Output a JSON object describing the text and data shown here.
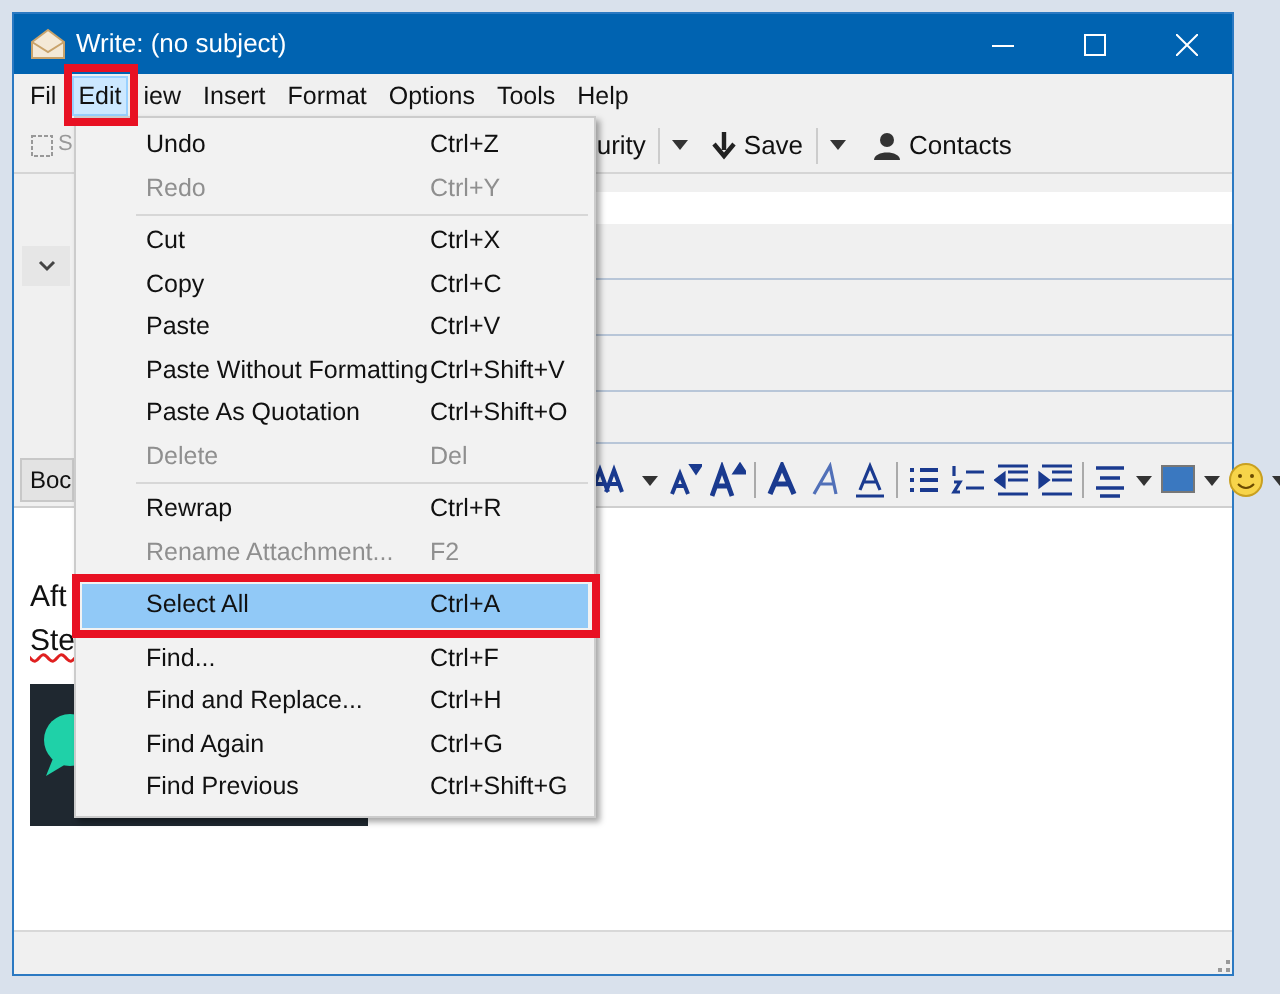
{
  "window": {
    "title": "Write: (no subject)"
  },
  "menubar": [
    {
      "label": "Fil",
      "selected": false
    },
    {
      "label": "Edit",
      "selected": true
    },
    {
      "label": "iew",
      "selected": false
    },
    {
      "label": "Insert",
      "selected": false
    },
    {
      "label": "Format",
      "selected": false
    },
    {
      "label": "Options",
      "selected": false
    },
    {
      "label": "Tools",
      "selected": false
    },
    {
      "label": "Help",
      "selected": false
    }
  ],
  "toolbar": {
    "left_label": "S",
    "security_label": "urity",
    "save_label": "Save",
    "contacts_label": "Contacts"
  },
  "format_toolbar": {
    "paragraph_label": "Boc"
  },
  "body": {
    "lines": [
      "Aft",
      "Ste"
    ]
  },
  "edit_menu": [
    {
      "kind": "item",
      "label": "Undo",
      "shortcut": "Ctrl+Z",
      "disabled": false,
      "selected": false
    },
    {
      "kind": "item",
      "label": "Redo",
      "shortcut": "Ctrl+Y",
      "disabled": true,
      "selected": false
    },
    {
      "kind": "separator"
    },
    {
      "kind": "item",
      "label": "Cut",
      "shortcut": "Ctrl+X",
      "disabled": false,
      "selected": false
    },
    {
      "kind": "item",
      "label": "Copy",
      "shortcut": "Ctrl+C",
      "disabled": false,
      "selected": false
    },
    {
      "kind": "item",
      "label": "Paste",
      "shortcut": "Ctrl+V",
      "disabled": false,
      "selected": false
    },
    {
      "kind": "item",
      "label": "Paste Without Formatting",
      "shortcut": "Ctrl+Shift+V",
      "disabled": false,
      "selected": false
    },
    {
      "kind": "item",
      "label": "Paste As Quotation",
      "shortcut": "Ctrl+Shift+O",
      "disabled": false,
      "selected": false
    },
    {
      "kind": "item",
      "label": "Delete",
      "shortcut": "Del",
      "disabled": true,
      "selected": false
    },
    {
      "kind": "separator"
    },
    {
      "kind": "item",
      "label": "Rewrap",
      "shortcut": "Ctrl+R",
      "disabled": false,
      "selected": false
    },
    {
      "kind": "item",
      "label": "Rename Attachment...",
      "shortcut": "F2",
      "disabled": true,
      "selected": false
    },
    {
      "kind": "separator"
    },
    {
      "kind": "item",
      "label": "Select All",
      "shortcut": "Ctrl+A",
      "disabled": false,
      "selected": true
    },
    {
      "kind": "separator"
    },
    {
      "kind": "item",
      "label": "Find...",
      "shortcut": "Ctrl+F",
      "disabled": false,
      "selected": false
    },
    {
      "kind": "item",
      "label": "Find and Replace...",
      "shortcut": "Ctrl+H",
      "disabled": false,
      "selected": false
    },
    {
      "kind": "item",
      "label": "Find Again",
      "shortcut": "Ctrl+G",
      "disabled": false,
      "selected": false
    },
    {
      "kind": "item",
      "label": "Find Previous",
      "shortcut": "Ctrl+Shift+G",
      "disabled": false,
      "selected": false
    }
  ]
}
